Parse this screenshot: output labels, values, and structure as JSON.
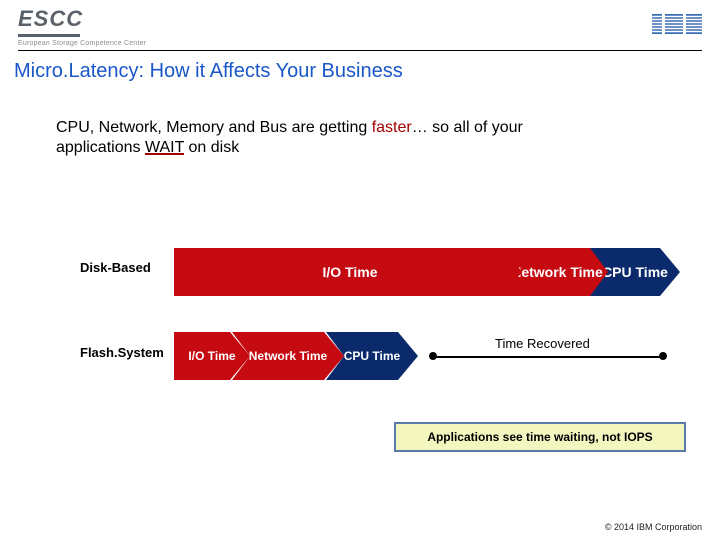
{
  "header": {
    "escc_letters": "ESCC",
    "escc_sub": "European Storage Competence Center",
    "ibm_label": "IBM"
  },
  "title": "Micro.Latency: How it Affects Your Business",
  "subtitle_pre": "CPU, Network, Memory and Bus are getting ",
  "subtitle_faster": "faster",
  "subtitle_mid": "… so all of your applications ",
  "subtitle_wait": "WAIT",
  "subtitle_post": " on disk",
  "rows": {
    "disk_label": "Disk-Based",
    "flash_label": "Flash.System",
    "disk": {
      "io": "I/O Time",
      "net": "Network Time",
      "cpu": "CPU Time"
    },
    "flash": {
      "io": "I/O Time",
      "net": "Network Time",
      "cpu": "CPU Time"
    }
  },
  "time_recovered": "Time Recovered",
  "callout": "Applications see time waiting, not IOPS",
  "footer": "© 2014 IBM Corporation"
}
